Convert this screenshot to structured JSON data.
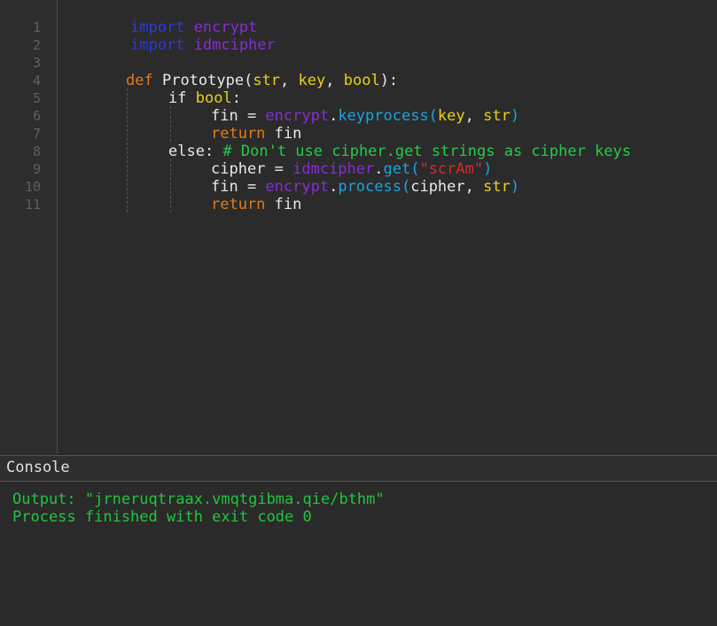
{
  "editor": {
    "line_numbers": [
      "1",
      "2",
      "3",
      "4",
      "5",
      "6",
      "7",
      "8",
      "9",
      "10",
      "11"
    ],
    "lines": {
      "l1": {
        "kw": "import",
        "mod": "encrypt"
      },
      "l2": {
        "kw": "import",
        "mod": "idmcipher"
      },
      "l4": {
        "kw": "def",
        "name": "Prototype(",
        "p1": "str",
        "sep1": ", ",
        "p2": "key",
        "sep2": ", ",
        "p3": "bool",
        "end": "):"
      },
      "l5": {
        "kw": "if",
        "cond": "bool",
        "colon": ":"
      },
      "l6": {
        "lhs": "fin = ",
        "mod": "encrypt",
        "dot": ".",
        "call": "keyprocess(",
        "a1": "key",
        "sep": ", ",
        "a2": "str",
        "end": ")"
      },
      "l7": {
        "kw": "return",
        "val": " fin"
      },
      "l8": {
        "kw": "else:",
        "comment": " # Don't use cipher.get strings as cipher keys"
      },
      "l9": {
        "lhs": "cipher = ",
        "mod": "idmcipher",
        "dot": ".",
        "call": "get(",
        "str": "\"scrAm\"",
        "end": ")"
      },
      "l10": {
        "lhs": "fin = ",
        "mod": "encrypt",
        "dot": ".",
        "call": "process(",
        "a1": "cipher",
        "sep": ", ",
        "a2": "str",
        "end": ")"
      },
      "l11": {
        "kw": "return",
        "val": " fin"
      }
    }
  },
  "console": {
    "title": "Console",
    "output_line": "Output: \"jrneruqtraax.vmqtgibma.qie/bthm\"",
    "status_line": "Process finished with exit code 0"
  },
  "colors": {
    "import_keyword": "#2a3bd6",
    "module": "#8a2bd6",
    "keyword": "#e07b1a",
    "parameter": "#e6d21a",
    "call": "#1aa3e0",
    "string": "#d62a2a",
    "comment": "#27c94a",
    "console_text": "#22c43e"
  }
}
